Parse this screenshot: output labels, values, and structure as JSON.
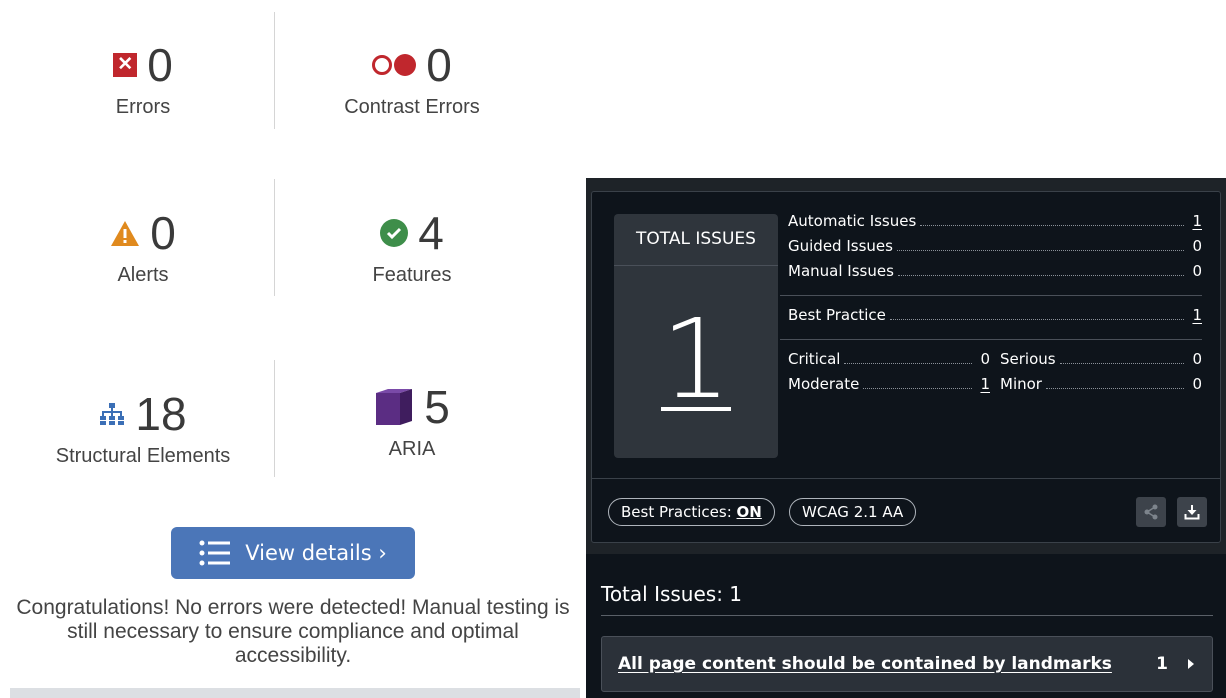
{
  "wave": {
    "stats": [
      {
        "value": "0",
        "label": "Errors",
        "icon": "error-icon"
      },
      {
        "value": "0",
        "label": "Contrast Errors",
        "icon": "contrast-icon"
      },
      {
        "value": "0",
        "label": "Alerts",
        "icon": "alert-icon"
      },
      {
        "value": "4",
        "label": "Features",
        "icon": "feature-icon"
      },
      {
        "value": "18",
        "label": "Structural Elements",
        "icon": "structure-icon"
      },
      {
        "value": "5",
        "label": "ARIA",
        "icon": "aria-icon"
      }
    ],
    "view_details_label": "View details ›",
    "congrats": "Congratulations! No errors were detected! Manual testing is still necessary to ensure compliance and optimal accessibility.",
    "colors": {
      "error": "#c0272d",
      "alert": "#e08a1e",
      "feature": "#3e8e4a",
      "structure": "#3b6fb6",
      "aria": "#5b2d83",
      "button": "#4b76b8"
    }
  },
  "axe": {
    "total_title": "TOTAL ISSUES",
    "total_value": "1",
    "rows": [
      {
        "name": "Automatic Issues",
        "value": "1"
      },
      {
        "name": "Guided Issues",
        "value": "0"
      },
      {
        "name": "Manual Issues",
        "value": "0"
      }
    ],
    "best_practice": {
      "name": "Best Practice",
      "value": "1"
    },
    "severity": [
      {
        "name": "Critical",
        "value": "0"
      },
      {
        "name": "Serious",
        "value": "0"
      },
      {
        "name": "Moderate",
        "value": "1"
      },
      {
        "name": "Minor",
        "value": "0"
      }
    ],
    "pill_best_practices": "Best Practices:",
    "pill_best_practices_state": "ON",
    "pill_standard": "WCAG 2.1 AA",
    "total_issues_heading": "Total Issues: 1",
    "issue": {
      "title": "All page content should be contained by landmarks",
      "count": "1"
    }
  }
}
